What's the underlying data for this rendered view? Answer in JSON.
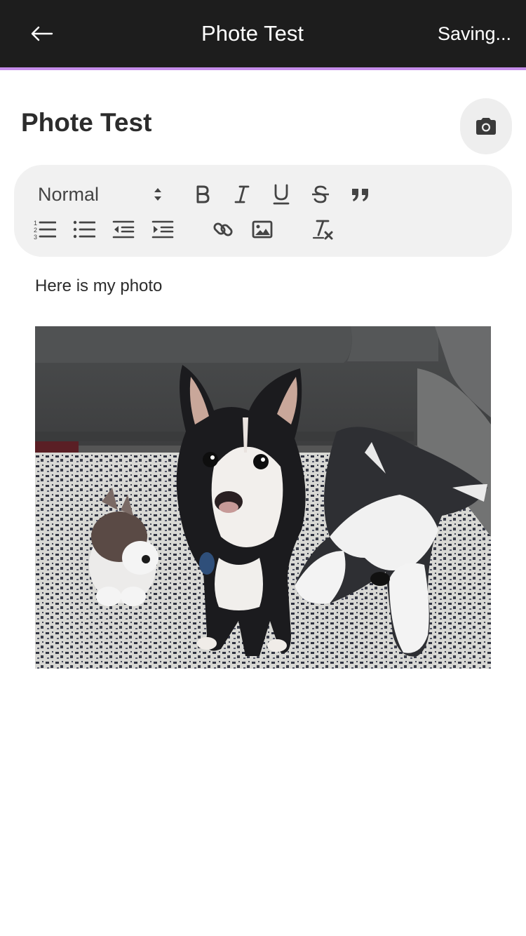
{
  "header": {
    "back_icon": "arrow-left-icon",
    "title": "Phote Test",
    "status": "Saving...",
    "background": "#1d1d1d",
    "accent_color": "#c58cea"
  },
  "note": {
    "title": "Phote Test",
    "camera_icon": "camera-icon",
    "body_text": "Here is my photo",
    "image": {
      "alt": "A black and white dog sitting on a rug between two husky plush toys in front of a grey couch"
    }
  },
  "toolbar": {
    "format_select": {
      "selected": "Normal"
    },
    "buttons_row1": [
      "bold-icon",
      "italic-icon",
      "underline-icon",
      "strikethrough-icon",
      "blockquote-icon"
    ],
    "buttons_row2": [
      "ordered-list-icon",
      "bullet-list-icon",
      "outdent-icon",
      "indent-icon",
      "link-icon",
      "image-icon",
      "clear-format-icon"
    ]
  }
}
